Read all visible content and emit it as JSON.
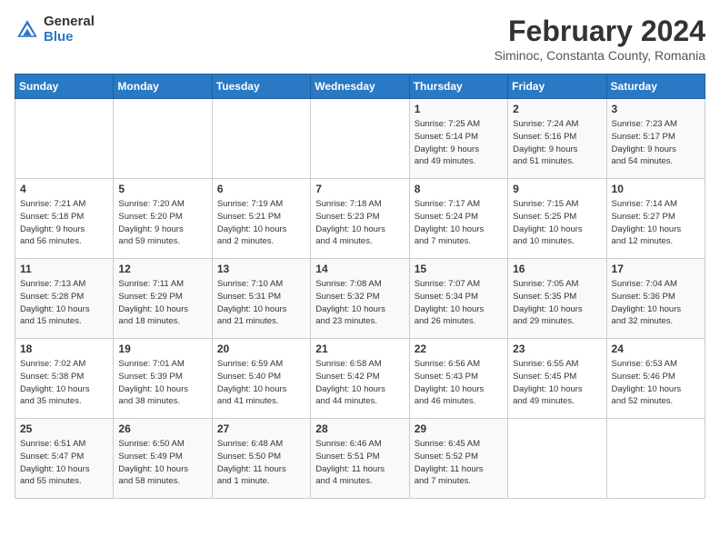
{
  "logo": {
    "general": "General",
    "blue": "Blue"
  },
  "title": "February 2024",
  "subtitle": "Siminoc, Constanta County, Romania",
  "weekdays": [
    "Sunday",
    "Monday",
    "Tuesday",
    "Wednesday",
    "Thursday",
    "Friday",
    "Saturday"
  ],
  "weeks": [
    [
      {
        "day": "",
        "info": ""
      },
      {
        "day": "",
        "info": ""
      },
      {
        "day": "",
        "info": ""
      },
      {
        "day": "",
        "info": ""
      },
      {
        "day": "1",
        "info": "Sunrise: 7:25 AM\nSunset: 5:14 PM\nDaylight: 9 hours\nand 49 minutes."
      },
      {
        "day": "2",
        "info": "Sunrise: 7:24 AM\nSunset: 5:16 PM\nDaylight: 9 hours\nand 51 minutes."
      },
      {
        "day": "3",
        "info": "Sunrise: 7:23 AM\nSunset: 5:17 PM\nDaylight: 9 hours\nand 54 minutes."
      }
    ],
    [
      {
        "day": "4",
        "info": "Sunrise: 7:21 AM\nSunset: 5:18 PM\nDaylight: 9 hours\nand 56 minutes."
      },
      {
        "day": "5",
        "info": "Sunrise: 7:20 AM\nSunset: 5:20 PM\nDaylight: 9 hours\nand 59 minutes."
      },
      {
        "day": "6",
        "info": "Sunrise: 7:19 AM\nSunset: 5:21 PM\nDaylight: 10 hours\nand 2 minutes."
      },
      {
        "day": "7",
        "info": "Sunrise: 7:18 AM\nSunset: 5:23 PM\nDaylight: 10 hours\nand 4 minutes."
      },
      {
        "day": "8",
        "info": "Sunrise: 7:17 AM\nSunset: 5:24 PM\nDaylight: 10 hours\nand 7 minutes."
      },
      {
        "day": "9",
        "info": "Sunrise: 7:15 AM\nSunset: 5:25 PM\nDaylight: 10 hours\nand 10 minutes."
      },
      {
        "day": "10",
        "info": "Sunrise: 7:14 AM\nSunset: 5:27 PM\nDaylight: 10 hours\nand 12 minutes."
      }
    ],
    [
      {
        "day": "11",
        "info": "Sunrise: 7:13 AM\nSunset: 5:28 PM\nDaylight: 10 hours\nand 15 minutes."
      },
      {
        "day": "12",
        "info": "Sunrise: 7:11 AM\nSunset: 5:29 PM\nDaylight: 10 hours\nand 18 minutes."
      },
      {
        "day": "13",
        "info": "Sunrise: 7:10 AM\nSunset: 5:31 PM\nDaylight: 10 hours\nand 21 minutes."
      },
      {
        "day": "14",
        "info": "Sunrise: 7:08 AM\nSunset: 5:32 PM\nDaylight: 10 hours\nand 23 minutes."
      },
      {
        "day": "15",
        "info": "Sunrise: 7:07 AM\nSunset: 5:34 PM\nDaylight: 10 hours\nand 26 minutes."
      },
      {
        "day": "16",
        "info": "Sunrise: 7:05 AM\nSunset: 5:35 PM\nDaylight: 10 hours\nand 29 minutes."
      },
      {
        "day": "17",
        "info": "Sunrise: 7:04 AM\nSunset: 5:36 PM\nDaylight: 10 hours\nand 32 minutes."
      }
    ],
    [
      {
        "day": "18",
        "info": "Sunrise: 7:02 AM\nSunset: 5:38 PM\nDaylight: 10 hours\nand 35 minutes."
      },
      {
        "day": "19",
        "info": "Sunrise: 7:01 AM\nSunset: 5:39 PM\nDaylight: 10 hours\nand 38 minutes."
      },
      {
        "day": "20",
        "info": "Sunrise: 6:59 AM\nSunset: 5:40 PM\nDaylight: 10 hours\nand 41 minutes."
      },
      {
        "day": "21",
        "info": "Sunrise: 6:58 AM\nSunset: 5:42 PM\nDaylight: 10 hours\nand 44 minutes."
      },
      {
        "day": "22",
        "info": "Sunrise: 6:56 AM\nSunset: 5:43 PM\nDaylight: 10 hours\nand 46 minutes."
      },
      {
        "day": "23",
        "info": "Sunrise: 6:55 AM\nSunset: 5:45 PM\nDaylight: 10 hours\nand 49 minutes."
      },
      {
        "day": "24",
        "info": "Sunrise: 6:53 AM\nSunset: 5:46 PM\nDaylight: 10 hours\nand 52 minutes."
      }
    ],
    [
      {
        "day": "25",
        "info": "Sunrise: 6:51 AM\nSunset: 5:47 PM\nDaylight: 10 hours\nand 55 minutes."
      },
      {
        "day": "26",
        "info": "Sunrise: 6:50 AM\nSunset: 5:49 PM\nDaylight: 10 hours\nand 58 minutes."
      },
      {
        "day": "27",
        "info": "Sunrise: 6:48 AM\nSunset: 5:50 PM\nDaylight: 11 hours\nand 1 minute."
      },
      {
        "day": "28",
        "info": "Sunrise: 6:46 AM\nSunset: 5:51 PM\nDaylight: 11 hours\nand 4 minutes."
      },
      {
        "day": "29",
        "info": "Sunrise: 6:45 AM\nSunset: 5:52 PM\nDaylight: 11 hours\nand 7 minutes."
      },
      {
        "day": "",
        "info": ""
      },
      {
        "day": "",
        "info": ""
      }
    ]
  ]
}
